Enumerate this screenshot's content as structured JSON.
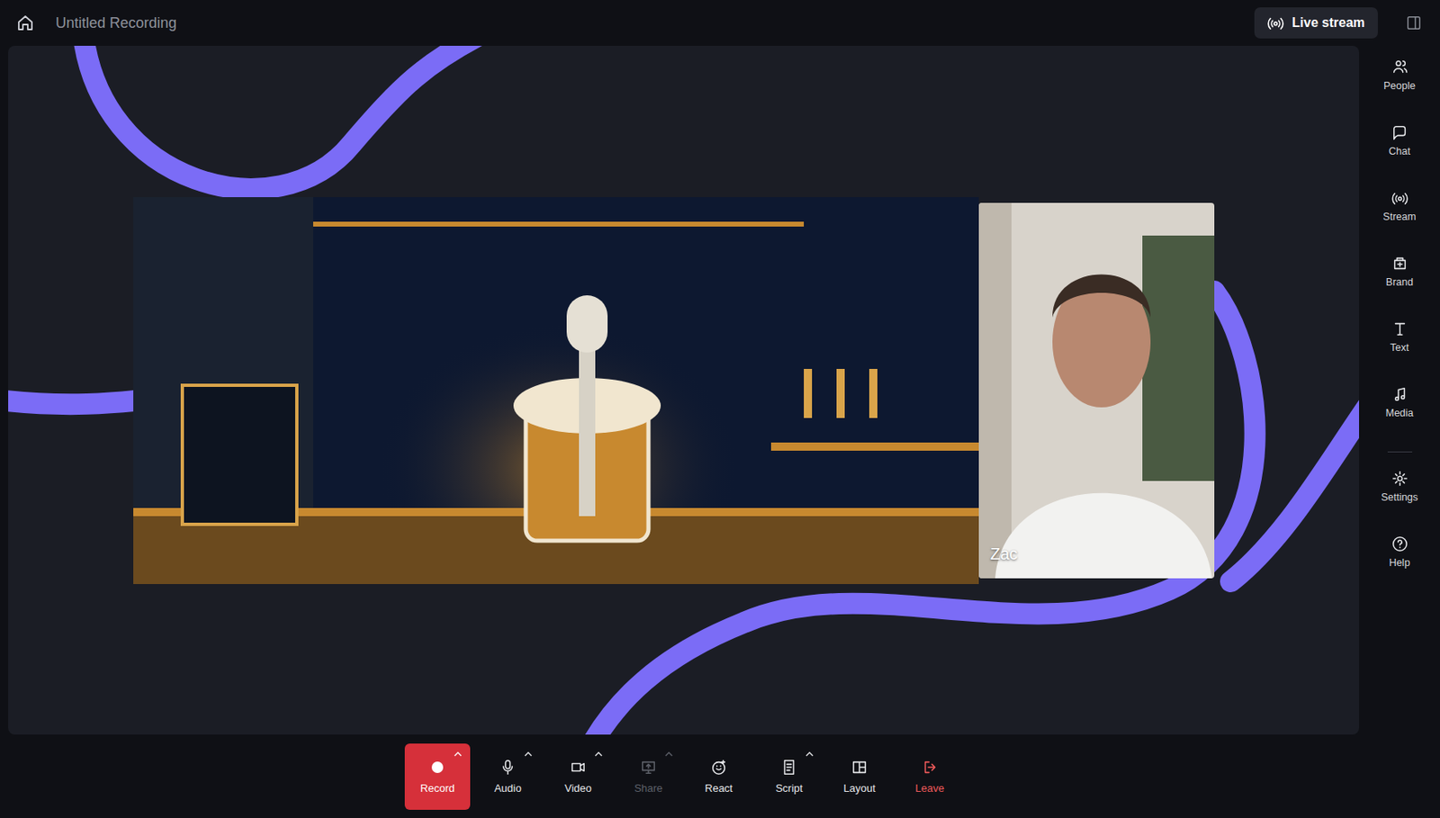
{
  "window": {
    "title": "Untitled Recording"
  },
  "header": {
    "live_stream": "Live stream"
  },
  "stage": {
    "participant": {
      "name": "Zac"
    }
  },
  "sidebar": {
    "items": [
      {
        "label": "People"
      },
      {
        "label": "Chat"
      },
      {
        "label": "Stream"
      },
      {
        "label": "Brand"
      },
      {
        "label": "Text"
      },
      {
        "label": "Media"
      }
    ],
    "bottom_items": [
      {
        "label": "Settings"
      },
      {
        "label": "Help"
      }
    ]
  },
  "toolbar": {
    "items": [
      {
        "label": "Record",
        "kind": "record",
        "disabled": false,
        "menu": true
      },
      {
        "label": "Audio",
        "kind": "normal",
        "disabled": false,
        "menu": true
      },
      {
        "label": "Video",
        "kind": "normal",
        "disabled": false,
        "menu": true
      },
      {
        "label": "Share",
        "kind": "normal",
        "disabled": true,
        "menu": true
      },
      {
        "label": "React",
        "kind": "normal",
        "disabled": false,
        "menu": false
      },
      {
        "label": "Script",
        "kind": "normal",
        "disabled": false,
        "menu": true
      },
      {
        "label": "Layout",
        "kind": "normal",
        "disabled": false,
        "menu": false
      },
      {
        "label": "Leave",
        "kind": "danger",
        "disabled": false,
        "menu": false
      }
    ]
  }
}
